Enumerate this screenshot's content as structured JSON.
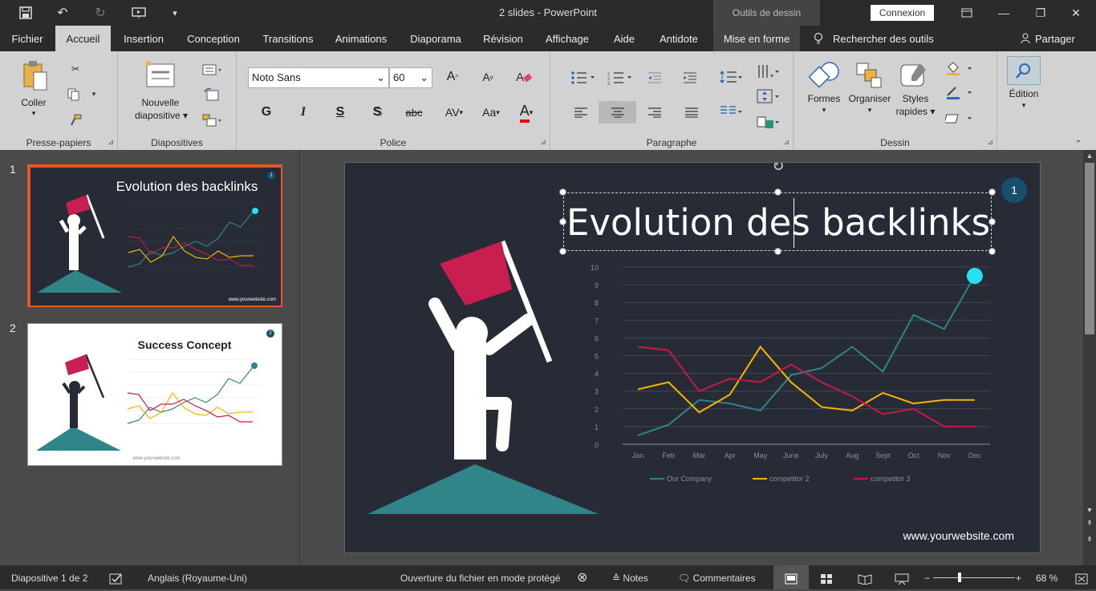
{
  "window": {
    "title": "2 slides  -  PowerPoint",
    "context_tab": "Outils de dessin",
    "connexion": "Connexion"
  },
  "tabs": [
    "Fichier",
    "Accueil",
    "Insertion",
    "Conception",
    "Transitions",
    "Animations",
    "Diaporama",
    "Révision",
    "Affichage",
    "Aide",
    "Antidote",
    "Mise en forme"
  ],
  "search": "Rechercher des outils adaptés",
  "share": "Partager",
  "ribbon": {
    "coller": "Coller",
    "nouvelle1": "Nouvelle",
    "nouvelle2": "diapositive",
    "font": "Noto Sans",
    "size": "60",
    "formes": "Formes",
    "organiser": "Organiser",
    "styles1": "Styles",
    "styles2": "rapides",
    "edition": "Édition",
    "groups": {
      "presse": "Presse-papiers",
      "diapos": "Diapositives",
      "police": "Police",
      "para": "Paragraphe",
      "dessin": "Dessin"
    },
    "font_buttons": [
      "G",
      "I",
      "S",
      "S",
      "abc",
      "AV",
      "Aa",
      "A"
    ]
  },
  "thumbs": [
    {
      "num": "1",
      "title": "Evolution des backlinks",
      "badge": "1",
      "url": "www.yourwebsite.com"
    },
    {
      "num": "2",
      "title": "Success Concept",
      "badge": "2",
      "url": "www.yourwebsite.com"
    }
  ],
  "slide": {
    "title": "Evolution des backlinks",
    "badge": "1",
    "url": "www.yourwebsite.com"
  },
  "colors": {
    "bg": "#262b36",
    "teal": "#2f8588",
    "red": "#c8184a",
    "yellow": "#f7b500",
    "cyan": "#25e2f0",
    "flag": "#c91f50"
  },
  "chart_data": {
    "type": "line",
    "categories": [
      "Jan",
      "Feb",
      "Mar",
      "Apr",
      "May",
      "June",
      "July",
      "Aug",
      "Sept",
      "Oct",
      "Nov",
      "Dec"
    ],
    "ylim": [
      0,
      10
    ],
    "yticks": [
      "0",
      "1",
      "2",
      "3",
      "4",
      "5",
      "6",
      "7",
      "8",
      "9",
      "10"
    ],
    "series": [
      {
        "name": "Our Company",
        "color": "#2f8588",
        "values": [
          0.5,
          1.1,
          2.5,
          2.3,
          1.9,
          3.9,
          4.3,
          5.5,
          4.1,
          7.3,
          6.5,
          9.5
        ]
      },
      {
        "name": "competitor 2",
        "color": "#f7b500",
        "values": [
          3.1,
          3.5,
          1.8,
          2.8,
          5.5,
          3.5,
          2.1,
          1.9,
          2.9,
          2.3,
          2.5,
          2.5
        ]
      },
      {
        "name": "competitor 3",
        "color": "#c8184a",
        "values": [
          5.5,
          5.3,
          3.0,
          3.7,
          3.5,
          4.5,
          3.5,
          2.7,
          1.7,
          2.0,
          1.0,
          1.0
        ]
      }
    ],
    "legend_position": "bottom",
    "grid": true
  },
  "status": {
    "slide": "Diapositive 1 de 2",
    "lang": "Anglais (Royaume-Uni)",
    "protected": "Ouverture du fichier en mode protégé",
    "notes": "Notes",
    "comments": "Commentaires",
    "zoom": "68 %"
  }
}
